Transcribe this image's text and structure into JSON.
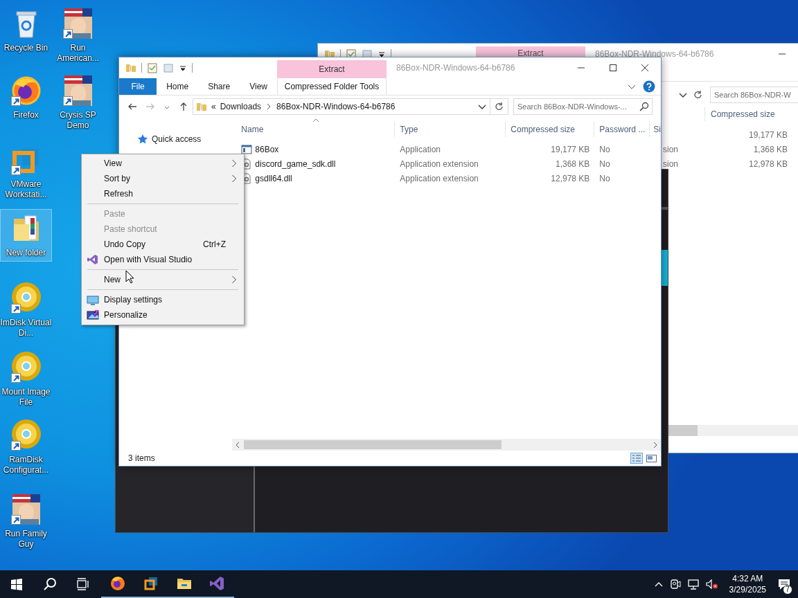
{
  "desktop_icons": [
    {
      "label": "Recycle Bin",
      "kind": "recycle-bin",
      "shortcut": false,
      "selected": false
    },
    {
      "label": "Run American...",
      "kind": "game",
      "shortcut": true,
      "selected": false
    },
    {
      "label": "Firefox",
      "kind": "firefox",
      "shortcut": true,
      "selected": false
    },
    {
      "label": "Crysis SP Demo",
      "kind": "game",
      "shortcut": true,
      "selected": false
    },
    {
      "label": "VMware Workstati...",
      "kind": "vmware",
      "shortcut": true,
      "selected": false
    },
    {
      "label": "New folder",
      "kind": "folder",
      "shortcut": false,
      "selected": true
    },
    {
      "label": "ImDisk Virtual Di...",
      "kind": "disc",
      "shortcut": true,
      "selected": false
    },
    {
      "label": "Mount Image File",
      "kind": "disc",
      "shortcut": true,
      "selected": false
    },
    {
      "label": "RamDisk Configurat...",
      "kind": "disc",
      "shortcut": true,
      "selected": false
    },
    {
      "label": "Run Family Guy",
      "kind": "game",
      "shortcut": true,
      "selected": false
    }
  ],
  "back_window": {
    "contextual_group": "Extract",
    "title": "86Box-NDR-Windows-64-b6786",
    "search": {
      "placeholder": "Search 86Box-NDR-W"
    },
    "column": "Compressed size",
    "rows": [
      {
        "size": "19,177 KB"
      },
      {
        "type_fragment": "sion",
        "size": "1,368 KB"
      },
      {
        "type_fragment": "sion",
        "size": "12,978 KB"
      }
    ]
  },
  "explorer": {
    "contextual_group": "Extract",
    "title": "86Box-NDR-Windows-64-b6786",
    "ribbon_tabs": [
      {
        "label": "File",
        "kind": "file",
        "selected": false
      },
      {
        "label": "Home",
        "kind": "tab",
        "selected": false
      },
      {
        "label": "Share",
        "kind": "tab",
        "selected": false
      },
      {
        "label": "View",
        "kind": "tab",
        "selected": false
      },
      {
        "label": "Compressed Folder Tools",
        "kind": "contextual",
        "selected": false
      }
    ],
    "address": {
      "overflow": "«",
      "path": [
        "Downloads",
        "86Box-NDR-Windows-64-b6786"
      ]
    },
    "search": {
      "placeholder": "Search 86Box-NDR-Windows-..."
    },
    "nav_items": [
      {
        "label": "Quick access"
      }
    ],
    "columns": [
      "Name",
      "Type",
      "Compressed size",
      "Password ...",
      "Si"
    ],
    "rows": [
      {
        "name": "86Box",
        "kind": "application",
        "type": "Application",
        "compressed_size": "19,177 KB",
        "password": "No"
      },
      {
        "name": "discord_game_sdk.dll",
        "kind": "extension",
        "type": "Application extension",
        "compressed_size": "1,368 KB",
        "password": "No"
      },
      {
        "name": "gsdll64.dll",
        "kind": "extension",
        "type": "Application extension",
        "compressed_size": "12,978 KB",
        "password": "No"
      }
    ],
    "status": "3 items"
  },
  "context_menu": [
    {
      "kind": "item",
      "label": "View",
      "submenu": true,
      "disabled": false
    },
    {
      "kind": "item",
      "label": "Sort by",
      "submenu": true,
      "disabled": false
    },
    {
      "kind": "item",
      "label": "Refresh",
      "submenu": false,
      "disabled": false
    },
    {
      "kind": "separator"
    },
    {
      "kind": "item",
      "label": "Paste",
      "submenu": false,
      "disabled": true
    },
    {
      "kind": "item",
      "label": "Paste shortcut",
      "submenu": false,
      "disabled": true
    },
    {
      "kind": "item",
      "label": "Undo Copy",
      "shortcut": "Ctrl+Z",
      "submenu": false,
      "disabled": false
    },
    {
      "kind": "studio-item",
      "label": "Open with Visual Studio",
      "submenu": false,
      "disabled": false
    },
    {
      "kind": "separator"
    },
    {
      "kind": "item",
      "label": "New",
      "submenu": true,
      "disabled": false
    },
    {
      "kind": "separator"
    },
    {
      "kind": "display-item",
      "label": "Display settings",
      "submenu": false,
      "disabled": false
    },
    {
      "kind": "personalize-item",
      "label": "Personalize",
      "submenu": false,
      "disabled": false
    }
  ],
  "taskbar": {
    "pinned": [
      {
        "kind": "firefox",
        "running": true
      },
      {
        "kind": "vmware",
        "running": true
      },
      {
        "kind": "explorer",
        "running": true
      },
      {
        "kind": "visual-studio",
        "running": true
      }
    ],
    "clock": {
      "time": "4:32 AM",
      "date": "3/29/2025"
    },
    "notifications": "7"
  }
}
